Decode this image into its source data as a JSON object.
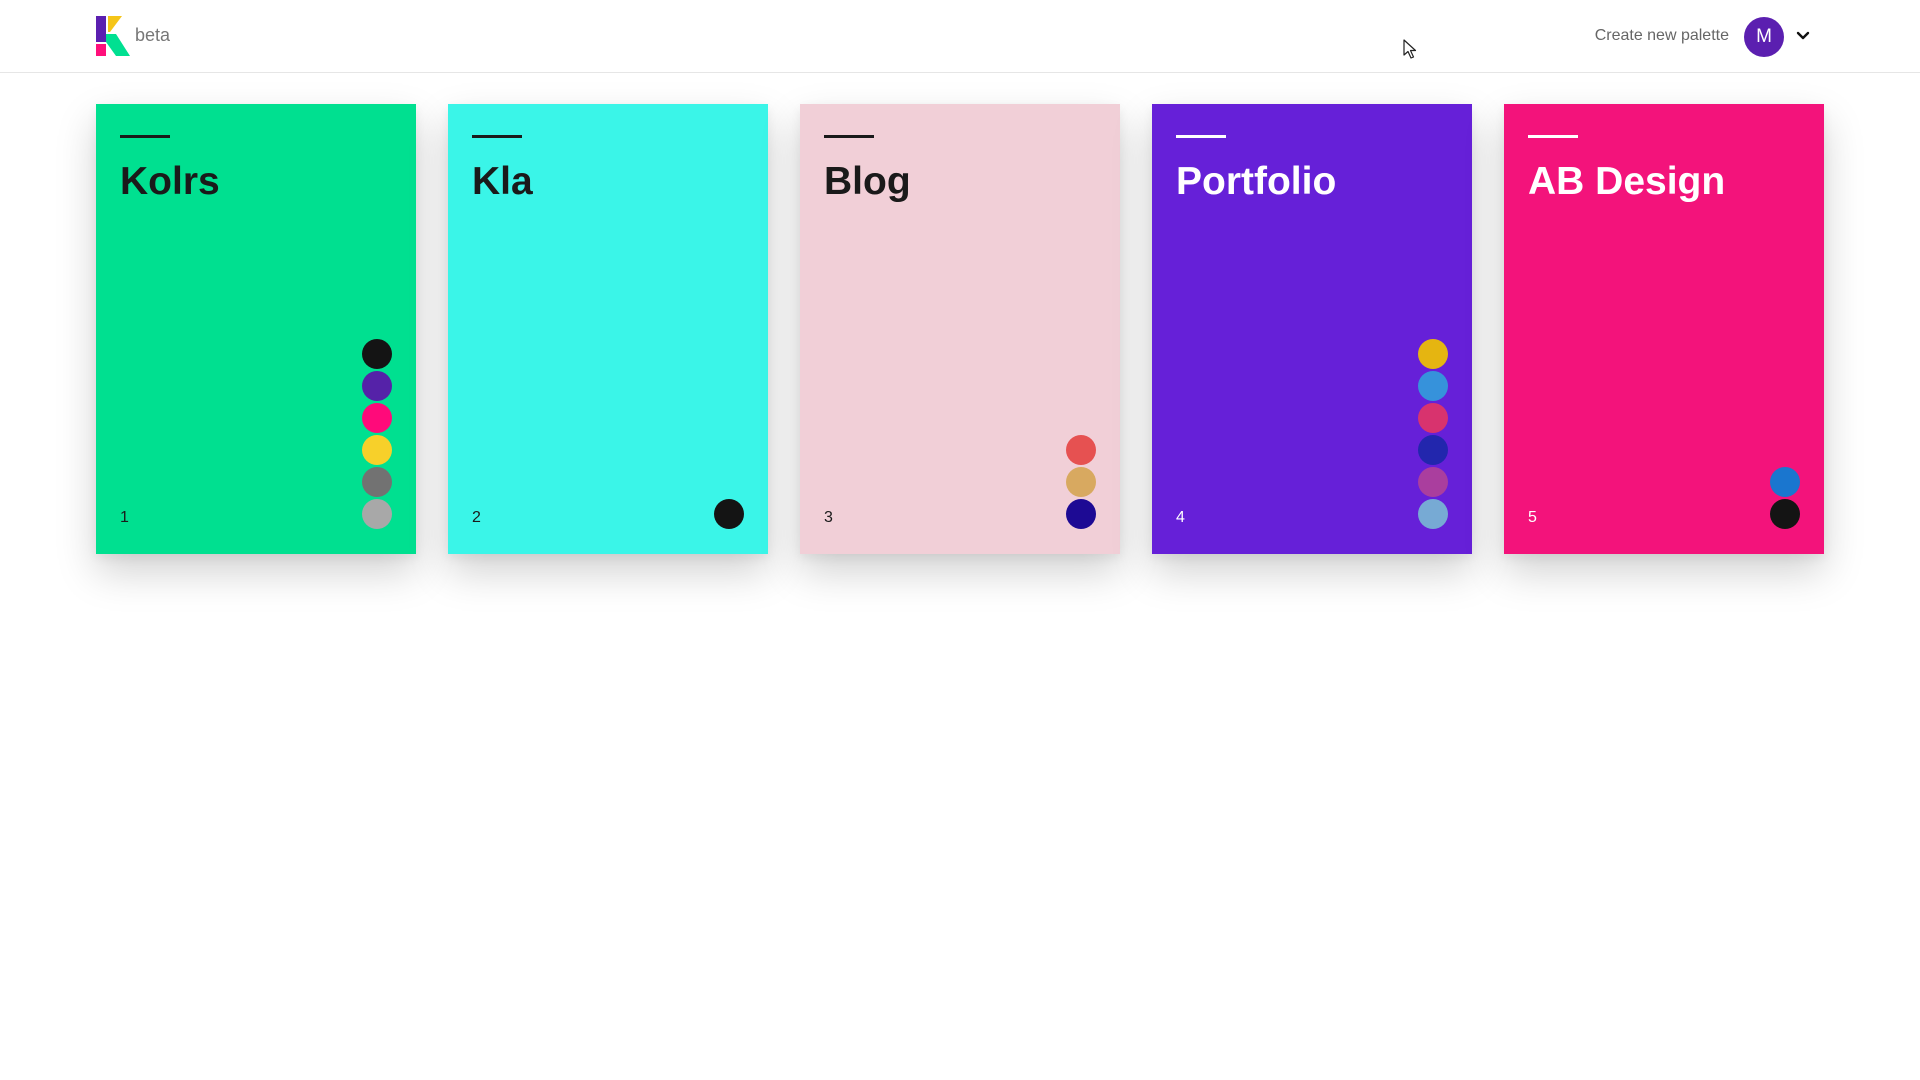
{
  "header": {
    "beta_label": "beta",
    "create_label": "Create new palette",
    "avatar_initial": "M",
    "avatar_color": "#5b1fb0",
    "logo_colors": [
      "#5b1fb0",
      "#f5c518",
      "#ff0f7b",
      "#00e091"
    ]
  },
  "palettes": [
    {
      "title": "Kolrs",
      "number": "1",
      "bg": "#00e090",
      "text": "#1a1a1a",
      "colors": [
        "#141414",
        "#5522a8",
        "#ff0a7a",
        "#f7d02a",
        "#727272",
        "#a8a8a8"
      ]
    },
    {
      "title": "Kla",
      "number": "2",
      "bg": "#3af5e8",
      "text": "#1a1a1a",
      "colors": [
        "#141414"
      ]
    },
    {
      "title": "Blog",
      "number": "3",
      "bg": "#f1cfd7",
      "text": "#1a1a1a",
      "colors": [
        "#e65151",
        "#d8a960",
        "#1d0a94"
      ]
    },
    {
      "title": "Portfolio",
      "number": "4",
      "bg": "#6620d8",
      "text": "#ffffff",
      "colors": [
        "#e5b511",
        "#3692db",
        "#d8336e",
        "#2226ad",
        "#aa3e9e",
        "#77aad4"
      ]
    },
    {
      "title": "AB Design",
      "number": "5",
      "bg": "#f3137b",
      "text": "#ffffff",
      "colors": [
        "#1a76cf",
        "#141414"
      ]
    }
  ]
}
